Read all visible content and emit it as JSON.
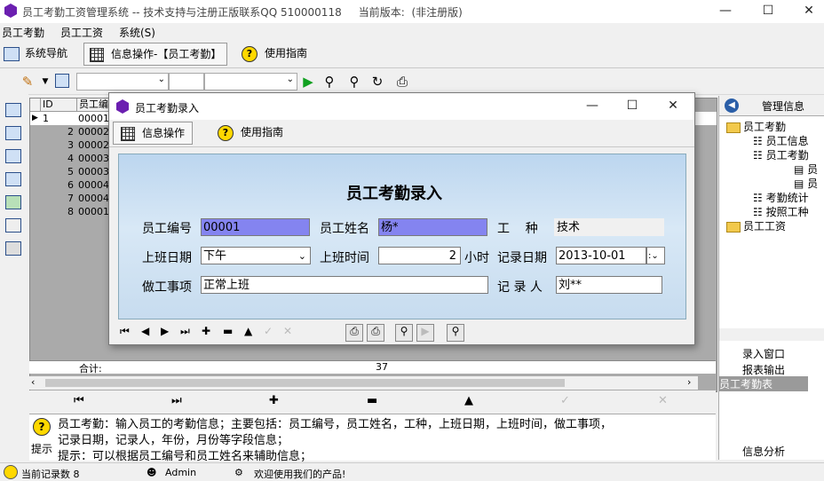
{
  "window": {
    "title": "员工考勤工资管理系统 -- 技术支持与注册正版联系QQ 510000118",
    "version_label": "当前版本:",
    "version_value": "(非注册版)"
  },
  "menu": [
    "员工考勤",
    "员工工资",
    "系统(S)"
  ],
  "tabs": [
    "系统导航",
    "信息操作-【员工考勤】",
    "使用指南"
  ],
  "grid": {
    "headers": [
      "ID",
      "员工编"
    ],
    "rows": [
      {
        "num": "1",
        "id": "00001"
      },
      {
        "num": "2",
        "id": "00002"
      },
      {
        "num": "3",
        "id": "00002"
      },
      {
        "num": "4",
        "id": "00003"
      },
      {
        "num": "5",
        "id": "00003"
      },
      {
        "num": "6",
        "id": "00004"
      },
      {
        "num": "7",
        "id": "00004"
      },
      {
        "num": "8",
        "id": "00001"
      }
    ],
    "total_label": "合计:",
    "total_value": "37"
  },
  "dialog": {
    "title": "员工考勤录入",
    "tabs": [
      "信息操作",
      "使用指南"
    ],
    "heading": "员工考勤录入",
    "fields": {
      "emp_no_label": "员工编号",
      "emp_no": "00001",
      "emp_name_label": "员工姓名",
      "emp_name": "杨*",
      "job_label": "工    种",
      "job": "技术",
      "shift_label": "上班日期",
      "shift": "下午",
      "hours_label": "上班时间",
      "hours": "2",
      "hours_unit": "小时",
      "date_label": "记录日期",
      "date": "2013-10-01",
      "work_label": "做工事项",
      "work": "正常上班",
      "recorder_label": "记 录 人",
      "recorder": "刘**"
    }
  },
  "right_panel": {
    "title": "管理信息",
    "tree": [
      "员工考勤",
      "员工信息",
      "员工考勤",
      "员",
      "员",
      "考勤统计",
      "按照工种",
      "员工工资"
    ],
    "links": [
      "录入窗口",
      "报表输出",
      "员工考勤表",
      "信息分析"
    ]
  },
  "hint": {
    "label": "提示",
    "line1": "员工考勤：输入员工的考勤信息；主要包括：员工编号，员工姓名，工种，上班日期，上班时间，做工事项，",
    "line2": "记录日期，记录人，年份，月份等字段信息；",
    "line3": "提示：可以根据员工编号和员工姓名来辅助信息；"
  },
  "status": {
    "records": "当前记录数 8",
    "user": "Admin",
    "welcome": "欢迎使用我们的产品!"
  }
}
